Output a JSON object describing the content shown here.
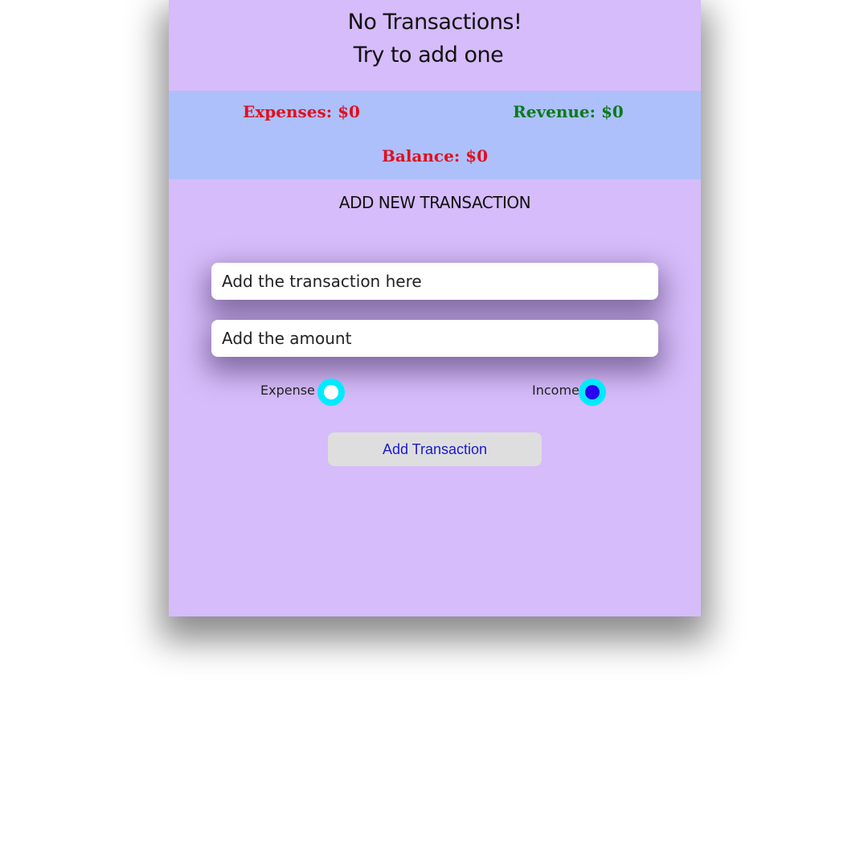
{
  "header": {
    "line1": "No Transactions!",
    "line2": "Try to add one"
  },
  "summary": {
    "expenses": "Expenses: $0",
    "revenue": "Revenue: $0",
    "balance": "Balance: $0"
  },
  "form": {
    "title": "ADD NEW TRANSACTION",
    "transaction_placeholder": "Add the transaction here",
    "transaction_value": "",
    "amount_placeholder": "Add the amount",
    "amount_value": "",
    "expense_label": "Expense",
    "income_label": "Income",
    "selected_type": "Income",
    "submit_label": "Add Transaction"
  },
  "colors": {
    "app_background": "#d6bcfa",
    "summary_background": "#adc0fc",
    "expenses_text": "#e0101e",
    "revenue_text": "#0a7a1a",
    "balance_text": "#e0101e",
    "radio_ring": "#00eaff",
    "radio_selected_dot": "#2a00f0",
    "button_background": "#dedede",
    "button_text": "#1a1ad0"
  }
}
